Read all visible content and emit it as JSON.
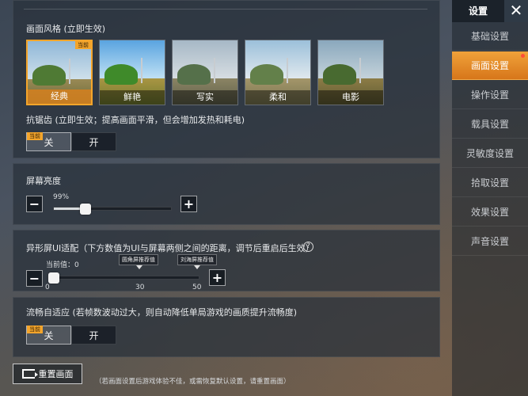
{
  "sidebar": {
    "title": "设置",
    "close": "✕",
    "items": [
      {
        "label": "基础设置"
      },
      {
        "label": "画面设置",
        "active": true
      },
      {
        "label": "操作设置"
      },
      {
        "label": "载具设置"
      },
      {
        "label": "灵敏度设置"
      },
      {
        "label": "拾取设置"
      },
      {
        "label": "效果设置"
      },
      {
        "label": "声音设置"
      }
    ]
  },
  "graphics_style": {
    "title": "画面风格 (立即生效)",
    "current_badge": "当前",
    "options": [
      "经典",
      "鲜艳",
      "写实",
      "柔和",
      "电影"
    ],
    "selected": "经典"
  },
  "antialias": {
    "title": "抗锯齿 (立即生效；提高画面平滑，但会增加发热和耗电)",
    "current_badge": "当前",
    "options": [
      "关",
      "开"
    ],
    "selected": "关"
  },
  "brightness": {
    "title": "屏幕亮度",
    "value_label": "99%",
    "value": 0.99,
    "minus": "−",
    "plus": "+"
  },
  "notch": {
    "title": "异形屏UI适配（下方数值为UI与屏幕两侧之间的距离，调节后重启后生效）",
    "help": "?",
    "current_label": "当前值：0",
    "value": 0,
    "max": 50,
    "rounded_tag": "圆角屏推荐值",
    "notch_tag": "刘海屏推荐值",
    "rounded_value": 30,
    "notch_value": 50,
    "ticks": [
      "0",
      "30",
      "50"
    ],
    "minus": "−",
    "plus": "+"
  },
  "adaptive": {
    "title": "流畅自适应 (若帧数波动过大，则自动降低单局游戏的画质提升流畅度)",
    "current_badge": "当前",
    "options": [
      "关",
      "开"
    ],
    "selected": "关"
  },
  "footer": {
    "reset_label": "重置画面",
    "note": "（若画面设置后游戏体验不佳，或需恢复默认设置，请重置画面）"
  }
}
